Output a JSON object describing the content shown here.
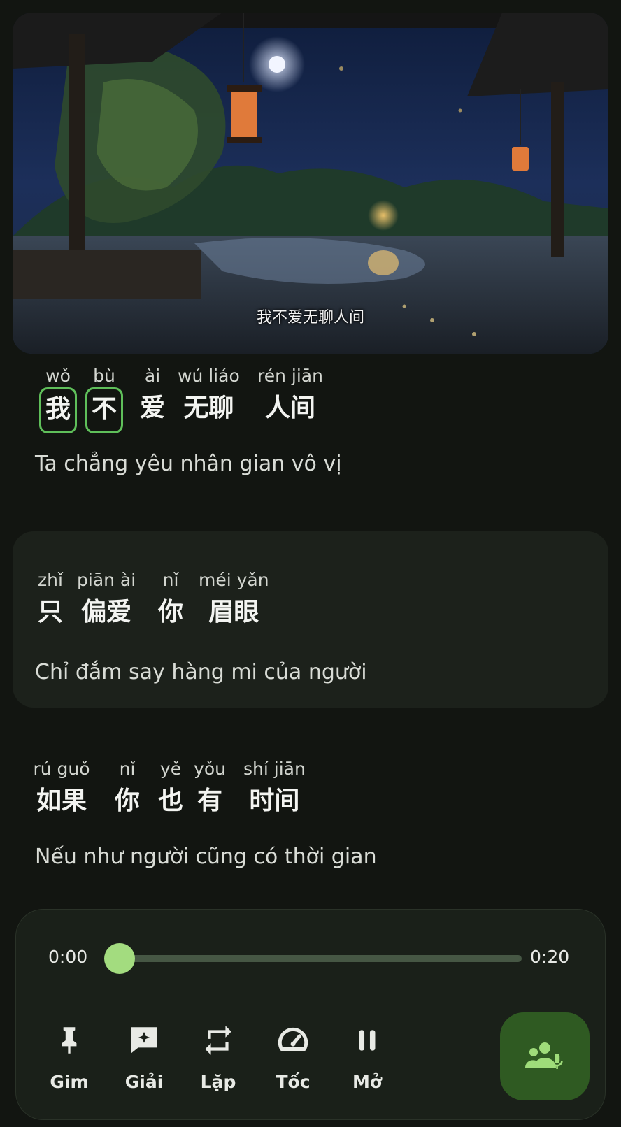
{
  "video": {
    "subtitle": "我不爱无聊人间"
  },
  "lyrics": [
    {
      "tokens": [
        {
          "pinyin": "wǒ",
          "hanzi": "我",
          "highlighted": true
        },
        {
          "pinyin": "bù",
          "hanzi": "不",
          "highlighted": true
        },
        {
          "pinyin": "ài",
          "hanzi": "爱",
          "highlighted": false
        },
        {
          "pinyin": "wú liáo",
          "hanzi": "无聊",
          "highlighted": false
        },
        {
          "pinyin": "rén jiān",
          "hanzi": "人间",
          "highlighted": false
        }
      ],
      "translation": "Ta chẳng yêu nhân gian vô vị"
    },
    {
      "tokens": [
        {
          "pinyin": "zhǐ",
          "hanzi": "只"
        },
        {
          "pinyin": "piān ài",
          "hanzi": "偏爱"
        },
        {
          "pinyin": "nǐ",
          "hanzi": "你"
        },
        {
          "pinyin": "méi yǎn",
          "hanzi": "眉眼"
        }
      ],
      "translation": "Chỉ đắm say hàng mi của người"
    },
    {
      "tokens": [
        {
          "pinyin": "rú guǒ",
          "hanzi": "如果"
        },
        {
          "pinyin": "nǐ",
          "hanzi": "你"
        },
        {
          "pinyin": "yě",
          "hanzi": "也"
        },
        {
          "pinyin": "yǒu",
          "hanzi": "有"
        },
        {
          "pinyin": "shí jiān",
          "hanzi": "时间"
        }
      ],
      "translation": "Nếu như người cũng có thời gian"
    }
  ],
  "player": {
    "current_time": "0:00",
    "total_time": "0:20",
    "progress": 0.0,
    "controls": [
      {
        "label": "Gim",
        "icon": "pin-icon"
      },
      {
        "label": "Giải",
        "icon": "sparkle-chat-icon"
      },
      {
        "label": "Lặp",
        "icon": "repeat-icon"
      },
      {
        "label": "Tốc",
        "icon": "speedometer-icon"
      },
      {
        "label": "Mở",
        "icon": "pause-icon"
      }
    ],
    "fab_icon": "group-voice-icon",
    "accent": "#a3dc7f",
    "highlight": "#5fbf5a"
  }
}
